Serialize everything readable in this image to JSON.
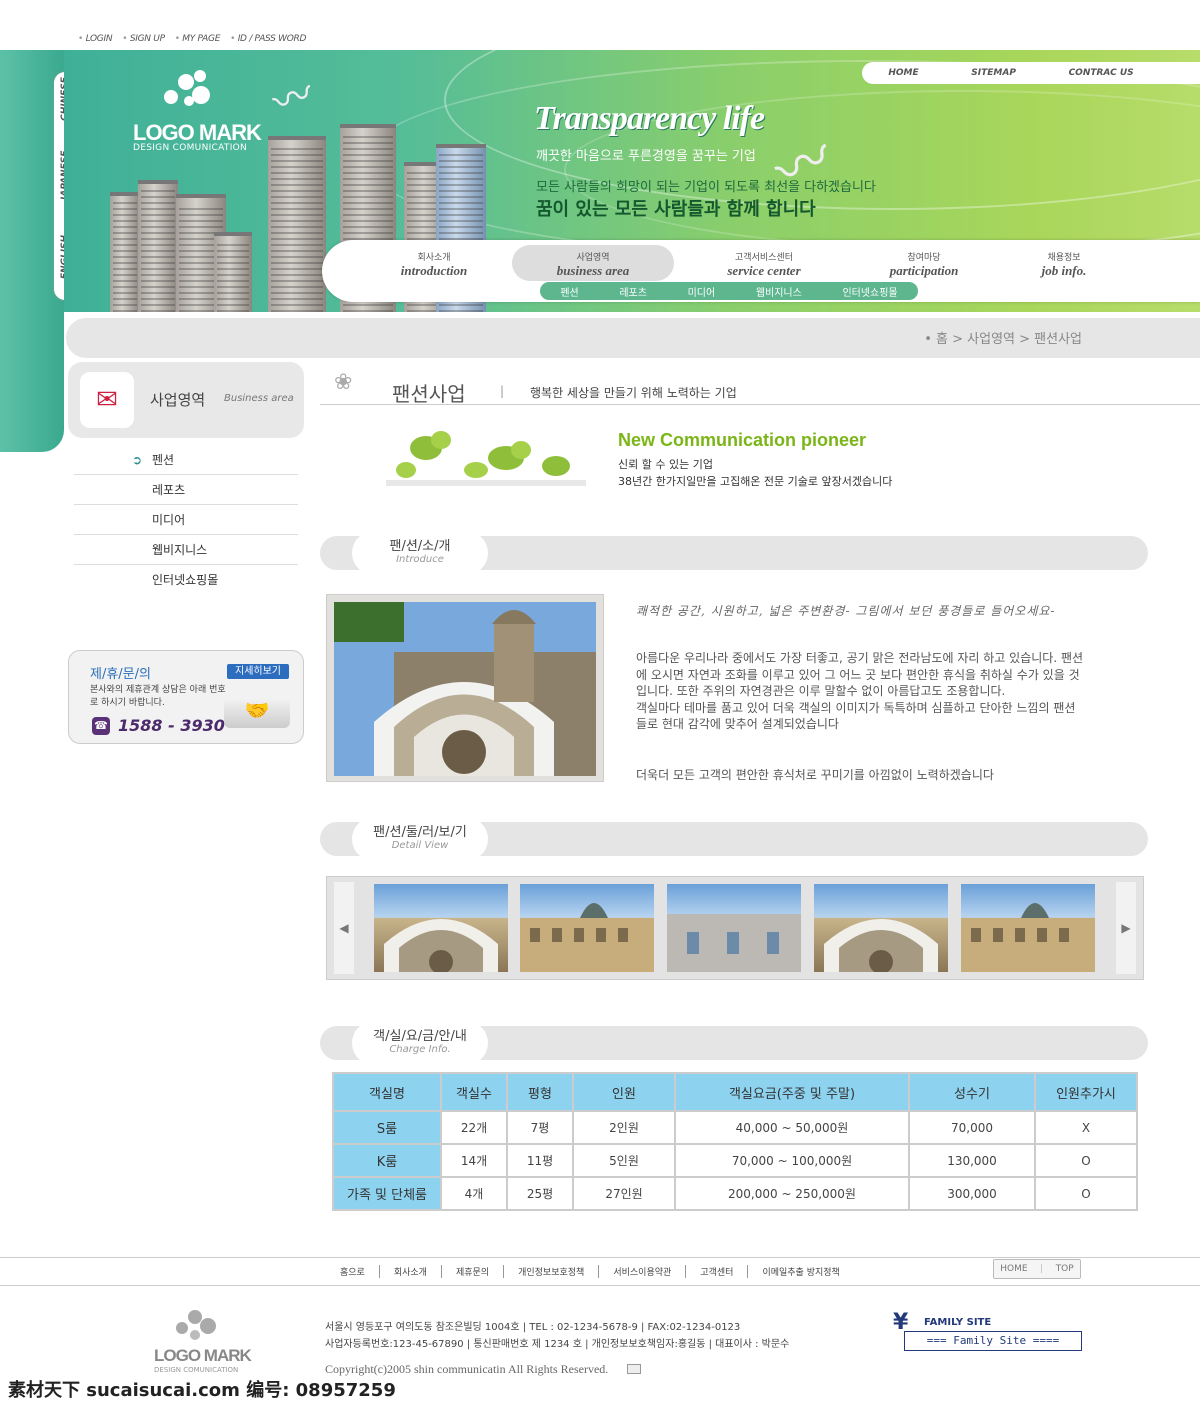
{
  "util_nav": [
    "LOGIN",
    "SIGN UP",
    "MY PAGE",
    "ID / PASS WORD"
  ],
  "languages": [
    "CHINESE",
    "JAPANESE",
    "ENGLISH"
  ],
  "logo": {
    "title": "LOGO MARK",
    "subtitle": "DESIGN COMUNICATION"
  },
  "banner": {
    "title": "Transparency  life",
    "subtitle": "깨끗한 마음으로 푸른경영을 꿈꾸는 기업",
    "line1": "모든 사람들의 희망이 되는 기업이 되도록 최선을 다하겠습니다",
    "line2": "꿈이 있는 모든 사람들과 함께 합니다"
  },
  "top_nav": [
    "HOME",
    "SITEMAP",
    "CONTRAC US"
  ],
  "main_nav": [
    {
      "ko": "회사소개",
      "en": "introduction"
    },
    {
      "ko": "사업영역",
      "en": "business area"
    },
    {
      "ko": "고객서비스센터",
      "en": "service center"
    },
    {
      "ko": "참여마당",
      "en": "participation"
    },
    {
      "ko": "채용정보",
      "en": "job info."
    }
  ],
  "sub_nav": [
    "펜션",
    "레포츠",
    "미디어",
    "웹비지니스",
    "인터넷쇼핑몰"
  ],
  "breadcrumb": "•  홈 > 사업영역 > 팬션사업",
  "sidebar": {
    "title": "사업영역",
    "subtitle": "Business area",
    "items": [
      "펜션",
      "레포츠",
      "미디어",
      "웹비지니스",
      "인터넷쇼핑몰"
    ]
  },
  "contact": {
    "title": "제/휴/문/의",
    "button": "지세히보기",
    "desc": "본사와의 제휴관계 상담은 아래 번호로 하시기 바랍니다.",
    "phone": "1588 - 3930"
  },
  "page": {
    "title": "팬션사업",
    "slogan": "행복한 세상을 만들기 위해 노력하는 기업",
    "np_title": "New Communication  pioneer",
    "np_line1": "신뢰 할 수 있는 기업",
    "np_line2": "38년간 한가지일만을 고집해온 전문 기술로 앞장서겠습니다"
  },
  "sections": {
    "intro": {
      "ko": "팬/션/소/개",
      "en": "Introduce"
    },
    "detail": {
      "ko": "팬/션/둘/러/보/기",
      "en": "Detail View"
    },
    "charge": {
      "ko": "객/실/요/금/안/내",
      "en": "Charge Info."
    }
  },
  "intro": {
    "handwriting": "쾌적한 공간, 시원하고, 넓은 주변환경- 그림에서 보던 풍경들로 들어오세요-",
    "body": "아름다운 우리나라 중에서도 가장 터좋고, 공기 맑은 전라남도에 자리 하고 있습니다. 팬션에 오시면 자연과 조화를 이루고 있어 그 어느 곳 보다 편안한 휴식을 취하실 수가 있을 것입니다. 또한 주위의 자연경관은 이루 말할수 없이 아름답고도 조용합니다.\n객실마다 테마를 품고 있어 더욱 객실의 이미지가 독특하며 심플하고 단아한 느낌의 팬션들로 현대 감각에 맞추어 설계되었습니다",
    "last": "더욱더 모든 고객의 편안한 휴식처로 꾸미기를 아낌없이 노력하겠습니다"
  },
  "gallery": {
    "prev": "◀",
    "next": "▶",
    "count": 5
  },
  "rates": {
    "headers": [
      "객실명",
      "객실수",
      "평형",
      "인원",
      "객실요금(주중 및 주말)",
      "성수기",
      "인원추가시"
    ],
    "rows": [
      [
        "S룸",
        "22개",
        "7평",
        "2인원",
        "40,000 ~ 50,000원",
        "70,000",
        "X"
      ],
      [
        "K룸",
        "14개",
        "11평",
        "5인원",
        "70,000 ~ 100,000원",
        "130,000",
        "O"
      ],
      [
        "가족 및 단체룸",
        "4개",
        "25평",
        "27인원",
        "200,000 ~ 250,000원",
        "300,000",
        "O"
      ]
    ]
  },
  "footer": {
    "nav": [
      "홈으로",
      "회사소개",
      "제휴문의",
      "개인정보보호정책",
      "서비스이용약관",
      "고객센터",
      "이메일추출 방지정책"
    ],
    "home": "HOME",
    "top": "TOP",
    "logo": "LOGO MARK",
    "logo_sub": "DESIGN COMUNICATION",
    "addr1": "서울시 영등포구 여의도동 참조은빌딩 1004호  |  TEL : 02-1234-5678-9  |  FAX:02-1234-0123",
    "addr2": "사업자등록번호:123-45-67890  |  통신판매번호 제 1234 호  |  개인정보보호책임자:홍길동  |  대표이사 : 박문수",
    "copyright": "Copyright(c)2005 shin communicatin All Rights Reserved.",
    "family_title": "FAMILY SITE",
    "family_select": "=== Family Site ===="
  },
  "watermark": "素材天下 sucaisucai.com   编号: 08957259"
}
